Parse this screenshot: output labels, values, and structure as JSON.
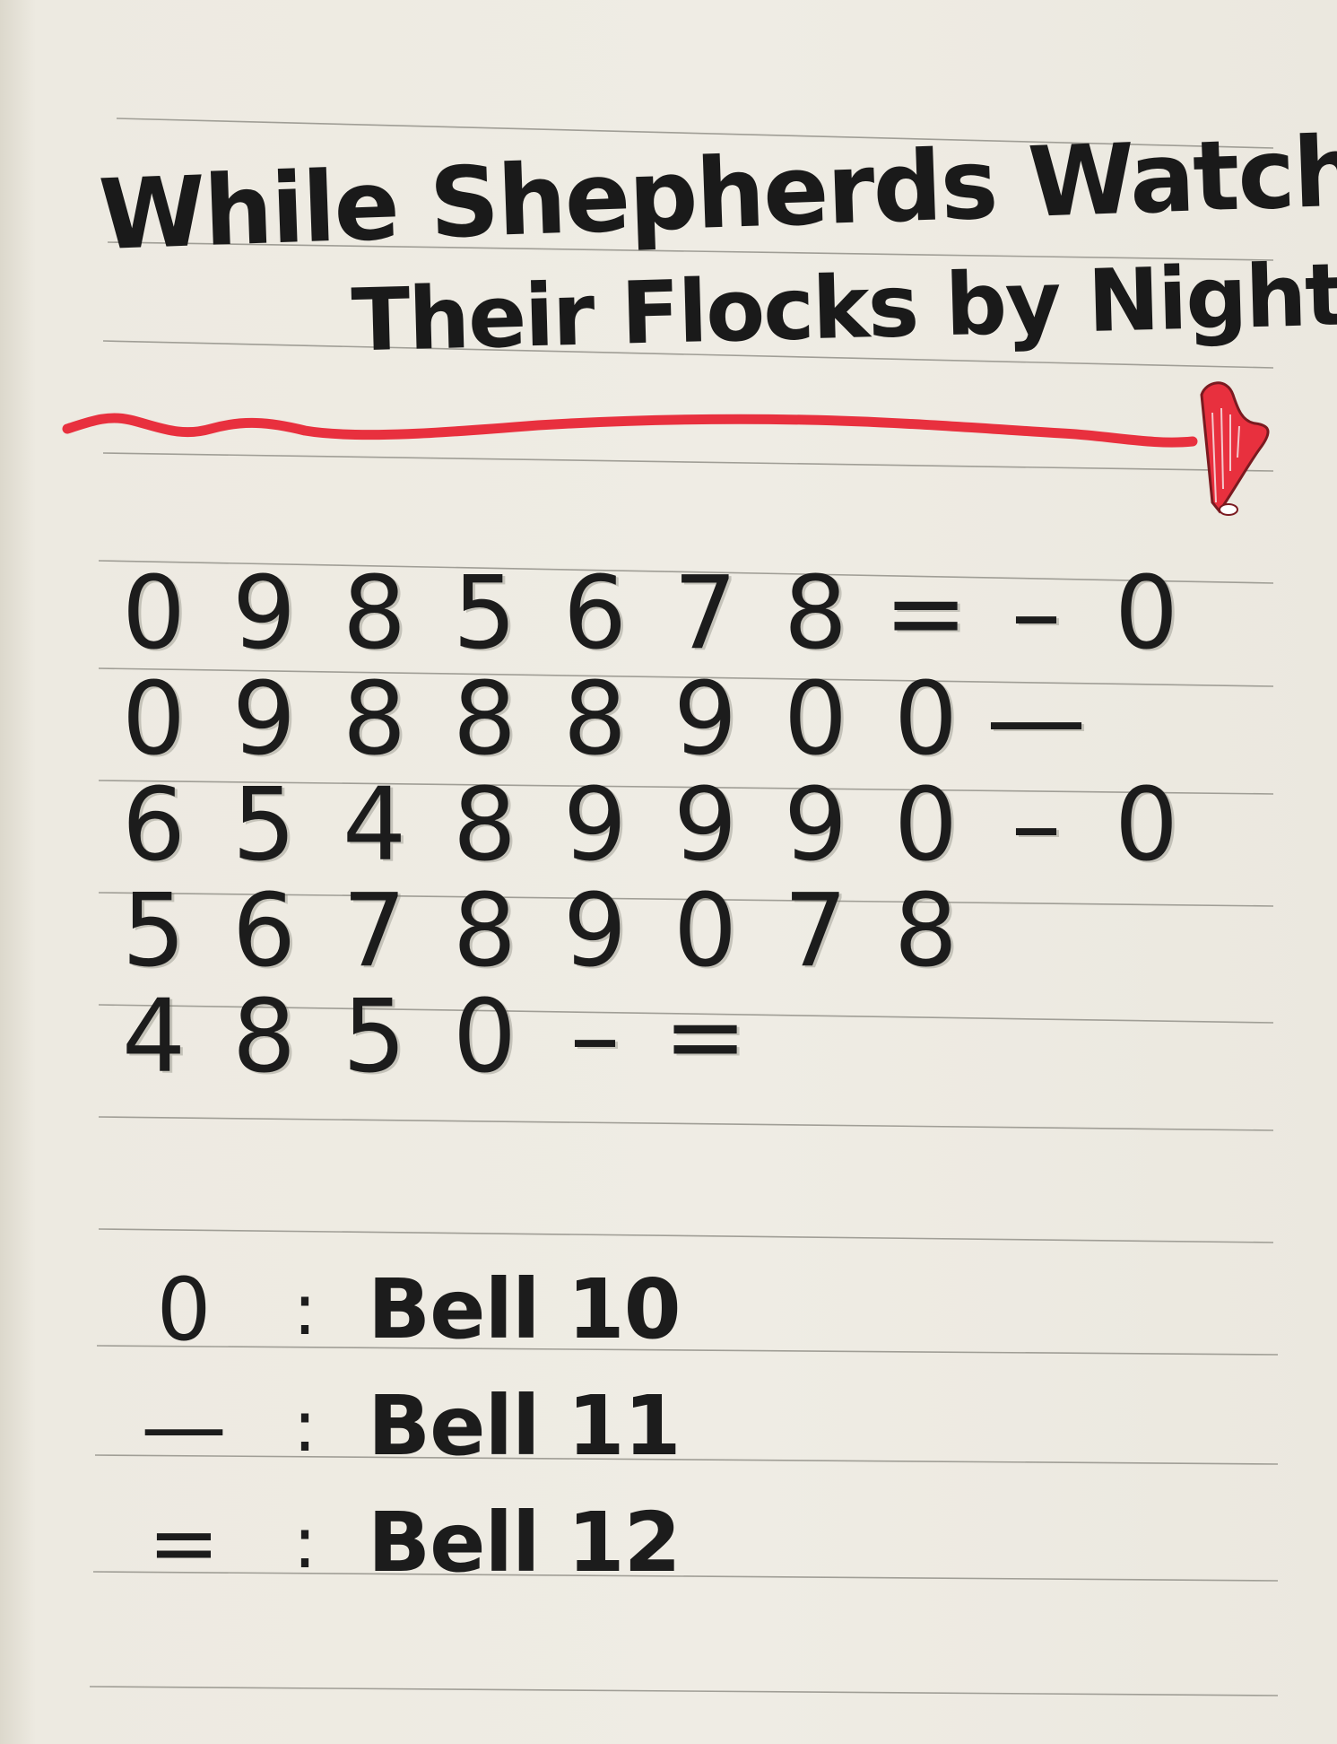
{
  "title": {
    "line1": "While Shepherds Watched",
    "line2": "Their Flocks by Night"
  },
  "notation": {
    "rows": [
      [
        "0",
        "9",
        "8",
        "5",
        "6",
        "7",
        "8",
        "=",
        "–",
        "0"
      ],
      [
        "0",
        "9",
        "8",
        "8",
        "8",
        "9",
        "0",
        "0",
        "—"
      ],
      [
        "6",
        "5",
        "4",
        "8",
        "9",
        "9",
        "9",
        "0",
        "–",
        "0"
      ],
      [
        "5",
        "6",
        "7",
        "8",
        "9",
        "0",
        "7",
        "8"
      ],
      [
        "4",
        "8",
        "5",
        "0",
        "–",
        "="
      ]
    ]
  },
  "legend": [
    {
      "symbol": "0",
      "separator": ":",
      "label": "Bell 10"
    },
    {
      "symbol": "—",
      "separator": ":",
      "label": "Bell 11"
    },
    {
      "symbol": "=",
      "separator": ":",
      "label": "Bell 12"
    }
  ],
  "colors": {
    "ink": "#1a1a1a",
    "red_marker": "#e8303e",
    "paper": "#edeae1",
    "rule_lines": "#9a9890"
  },
  "icon": "harp-icon"
}
